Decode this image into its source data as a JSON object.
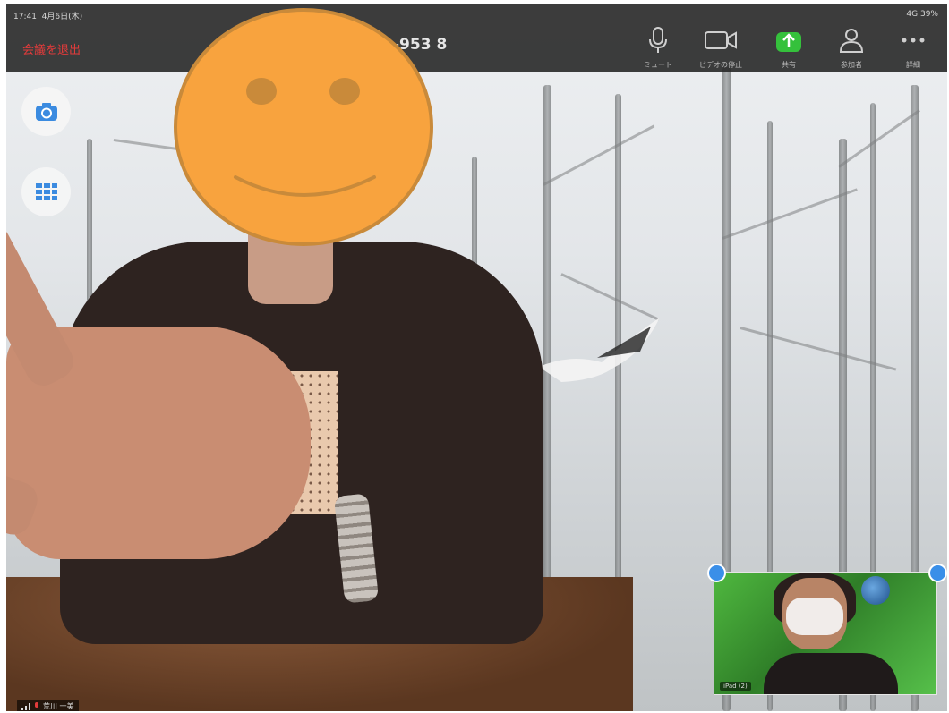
{
  "status_bar": {
    "time": "17:41",
    "date": "4月6日(木)",
    "battery": "4G 39%"
  },
  "toolbar": {
    "leave_label": "会議を退出",
    "meeting_id": "-953 8",
    "buttons": [
      {
        "label": "ミュート",
        "icon": "microphone-icon"
      },
      {
        "label": "ビデオの停止",
        "icon": "video-camera-icon"
      },
      {
        "label": "共有",
        "icon": "share-icon"
      },
      {
        "label": "参加者",
        "icon": "participants-icon"
      },
      {
        "label": "詳細",
        "icon": "more-icon"
      }
    ]
  },
  "side_controls": {
    "switch_camera_icon": "camera-switch-icon",
    "gallery_icon": "grid-view-icon"
  },
  "self_view": {
    "name": "iPad (2)"
  },
  "speaker_tag": {
    "name": "荒川 一美"
  },
  "colors": {
    "toolbar_bg": "#282828",
    "leave_red": "#e23b3b",
    "share_green": "#35c13c",
    "handle_blue": "#3a8fe8",
    "smiley_fill": "#f8a33e"
  }
}
